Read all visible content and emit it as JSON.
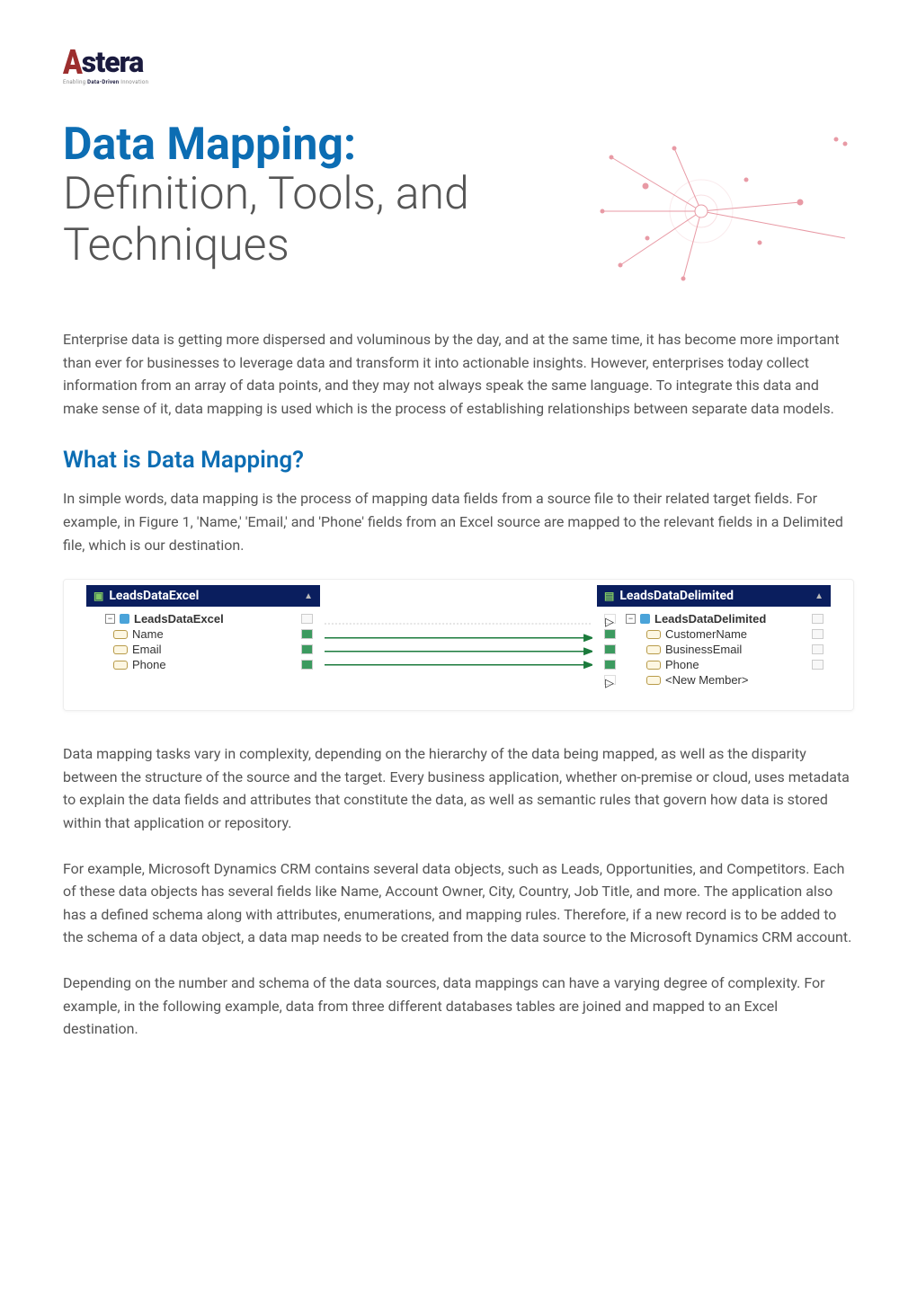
{
  "logo": {
    "brand": "stera",
    "tagline_pre": "Enabling ",
    "tagline_bold": "Data-Driven",
    "tagline_post": " Innovation"
  },
  "hero": {
    "title_strong": "Data Mapping:",
    "title_rest": "Definition, Tools, and Techniques"
  },
  "intro": "Enterprise data is getting more dispersed and voluminous by the day, and at the same time, it has become more important than ever for businesses to leverage data and transform it into actionable insights. However, enterprises today collect information from an array of data points, and they may not always speak the same language. To integrate this data and make sense of it, data mapping is used which is the process of establishing relationships between separate data models.",
  "section1": {
    "heading": "What is Data Mapping?",
    "para": "In simple words, data mapping is the process of mapping data fields from a source file to their related target fields. For example, in Figure 1, 'Name,' 'Email,' and 'Phone' fields from an Excel source are mapped to the relevant fields in a Delimited file, which is our destination."
  },
  "mapping": {
    "source": {
      "title": "LeadsDataExcel",
      "group": "LeadsDataExcel",
      "fields": [
        "Name",
        "Email",
        "Phone"
      ]
    },
    "target": {
      "title": "LeadsDataDelimited",
      "group": "LeadsDataDelimited",
      "fields": [
        "CustomerName",
        "BusinessEmail",
        "Phone",
        "<New Member>"
      ]
    }
  },
  "body_paras": [
    "Data mapping tasks vary in complexity, depending on the hierarchy of the data being mapped, as well as the disparity between the structure of the source and the target. Every business application, whether on-premise or cloud, uses metadata to explain the data fields and attributes that constitute the data, as well as semantic rules that govern how data is stored within that application or repository.",
    "For example, Microsoft Dynamics CRM contains several data objects, such as Leads, Opportunities, and Competitors. Each of these data objects has several fields like Name, Account Owner, City, Country, Job Title, and more. The application also has a defined schema along with attributes, enumerations, and mapping rules. Therefore, if a new record is to be added to the schema of a data object, a data map needs to be created from the data source to the Microsoft Dynamics CRM account.",
    "Depending on the number and schema of the data sources, data mappings can have a varying degree of complexity. For example, in the following example, data from three different databases tables are joined and mapped to an Excel destination."
  ]
}
